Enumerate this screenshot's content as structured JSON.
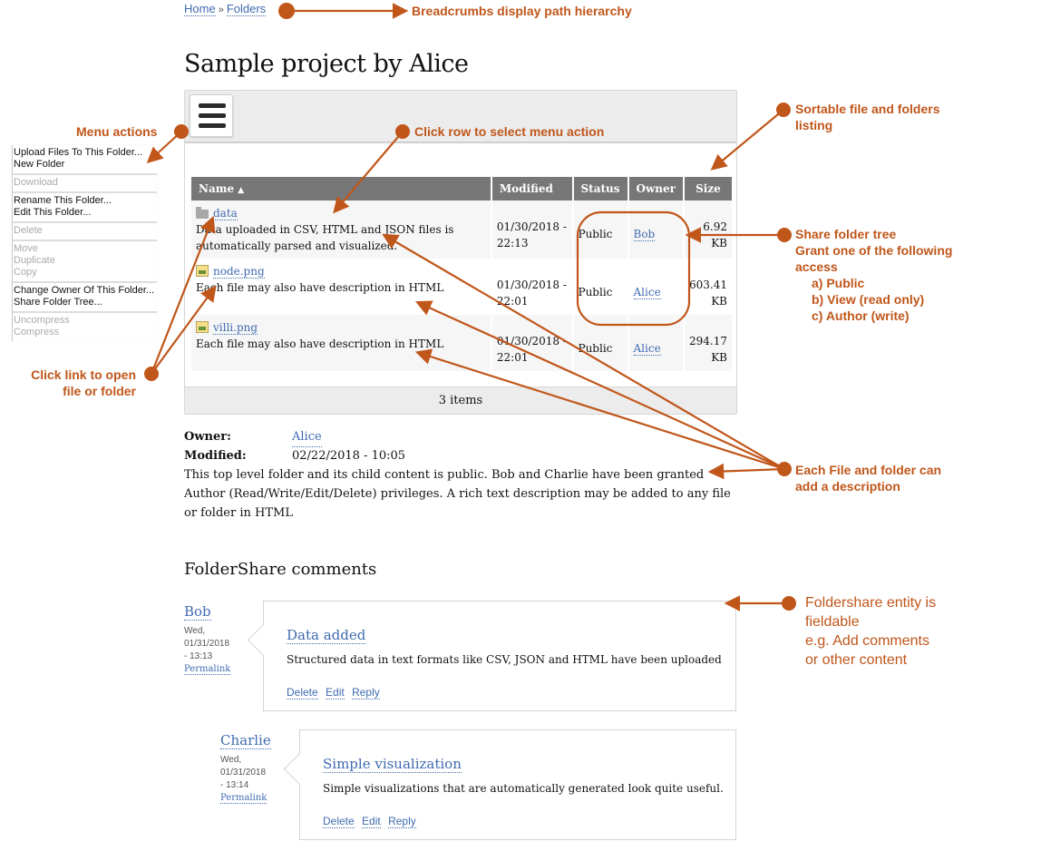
{
  "breadcrumb": {
    "items": [
      "Home",
      "Folders"
    ],
    "separator": "»"
  },
  "page_title": "Sample project by Alice",
  "toolbar": {
    "menu_icon": "hamburger-menu-icon"
  },
  "file_table": {
    "columns": [
      "Name",
      "Modified",
      "Status",
      "Owner",
      "Size"
    ],
    "sort_indicator": "▲",
    "rows": [
      {
        "icon": "folder-icon",
        "name": "data",
        "description": "Data uploaded in CSV, HTML and JSON files is automatically parsed and visualized.",
        "modified_date": "01/30/2018 -",
        "modified_time": "22:13",
        "status": "Public",
        "owner": "Bob",
        "size_value": "6.92",
        "size_unit": "KB"
      },
      {
        "icon": "image-file-icon",
        "name": "node.png",
        "description": "Each file may also have description in HTML",
        "modified_date": "01/30/2018 -",
        "modified_time": "22:01",
        "status": "Public",
        "owner": "Alice",
        "size_value": "603.41",
        "size_unit": "KB"
      },
      {
        "icon": "image-file-icon",
        "name": "villi.png",
        "description": "Each file may also have description in HTML",
        "modified_date": "01/30/2018 -",
        "modified_time": "22:01",
        "status": "Public",
        "owner": "Alice",
        "size_value": "294.17",
        "size_unit": "KB"
      }
    ],
    "item_count": "3 items"
  },
  "folder_meta": {
    "owner_label": "Owner:",
    "owner": "Alice",
    "modified_label": "Modified:",
    "modified": "02/22/2018 - 10:05",
    "description": "This top level folder and its child content is public. Bob and Charlie have been granted Author (Read/Write/Edit/Delete) privileges. A rich text description may be added to any file or folder in HTML"
  },
  "comments": {
    "title": "FolderShare comments",
    "items": [
      {
        "author": "Bob",
        "day": "Wed,",
        "date": "01/31/2018",
        "time": "- 13:13",
        "permalink": "Permalink",
        "subject": "Data added",
        "body": "Structured data in text formats like CSV, JSON and HTML have been uploaded",
        "actions": [
          "Delete",
          "Edit",
          "Reply"
        ]
      },
      {
        "author": "Charlie",
        "day": "Wed,",
        "date": "01/31/2018",
        "time": "- 13:14",
        "permalink": "Permalink",
        "subject": "Simple visualization",
        "body": "Simple visualizations that are automatically generated look quite useful.",
        "actions": [
          "Delete",
          "Edit",
          "Reply"
        ]
      }
    ]
  },
  "context_menu": {
    "groups": [
      [
        {
          "label": "Upload Files To This Folder...",
          "enabled": true
        },
        {
          "label": "New Folder",
          "enabled": true
        }
      ],
      [
        {
          "label": "Download",
          "enabled": false
        }
      ],
      [
        {
          "label": "Rename This Folder...",
          "enabled": true
        },
        {
          "label": "Edit This Folder...",
          "enabled": true
        }
      ],
      [
        {
          "label": "Delete",
          "enabled": false
        }
      ],
      [
        {
          "label": "Move",
          "enabled": false
        },
        {
          "label": "Duplicate",
          "enabled": false
        },
        {
          "label": "Copy",
          "enabled": false
        }
      ],
      [
        {
          "label": "Change Owner Of This Folder...",
          "enabled": true
        },
        {
          "label": "Share Folder Tree...",
          "enabled": true
        }
      ],
      [
        {
          "label": "Uncompress",
          "enabled": false
        },
        {
          "label": "Compress",
          "enabled": false
        }
      ]
    ]
  },
  "annotations": {
    "color": "#c0561a",
    "breadcrumbs": "Breadcrumbs display path hierarchy",
    "menu_actions": "Menu actions",
    "click_row": "Click row to select menu action",
    "sortable_1": "Sortable file and folders",
    "sortable_2": "listing",
    "click_link_1": "Click link to open",
    "click_link_2": "file or folder",
    "share_1": "Share folder tree",
    "share_2": "Grant one of the following",
    "share_3": "access",
    "share_a": "a) Public",
    "share_b": "b) View (read only)",
    "share_c": "c) Author (write)",
    "desc_1": "Each File and folder can",
    "desc_2": "add a description",
    "fieldable_1": "Foldershare entity is",
    "fieldable_2": "fieldable",
    "fieldable_3": "e.g. Add comments",
    "fieldable_4": "or other content"
  }
}
